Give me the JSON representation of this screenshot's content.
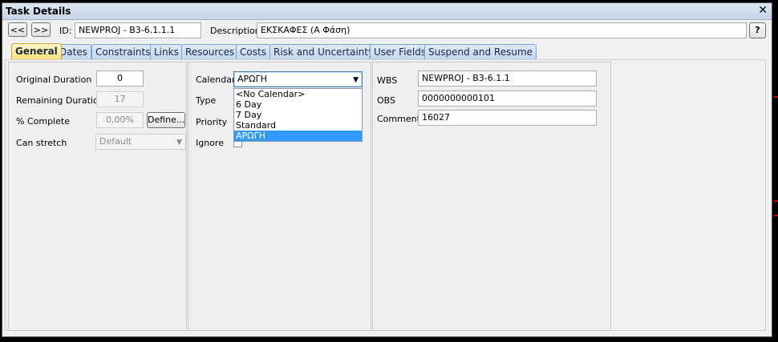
{
  "window": {
    "title": "Task Details",
    "close_glyph": "✕"
  },
  "header": {
    "prev_label": "<<",
    "next_label": ">>",
    "id_label": "ID:",
    "id_value": "NEWPROJ - B3-6.1.1.1",
    "description_label": "Description:",
    "description_value": "ΕΚΣΚΑΦΕΣ (Α Φάση)",
    "help_label": "?"
  },
  "tabs": [
    {
      "label": "General",
      "active": true
    },
    {
      "label": "Dates"
    },
    {
      "label": "Constraints"
    },
    {
      "label": "Links"
    },
    {
      "label": "Resources"
    },
    {
      "label": "Costs"
    },
    {
      "label": "Risk and Uncertainty"
    },
    {
      "label": "User Fields"
    },
    {
      "label": "Suspend and Resume"
    }
  ],
  "general": {
    "original_duration_label": "Original Duration",
    "original_duration_value": "0",
    "remaining_duration_label": "Remaining Duration",
    "remaining_duration_value": "17",
    "percent_complete_label": "% Complete",
    "percent_complete_value": "0,00%",
    "define_label": "Define...",
    "can_stretch_label": "Can stretch",
    "can_stretch_value": "Default"
  },
  "middle": {
    "calendar_label": "Calendar",
    "calendar_value": "ΑΡΩΓΗ",
    "type_label": "Type",
    "priority_label": "Priority",
    "ignore_label": "Ignore",
    "calendar_options": [
      "<No Calendar>",
      "6 Day",
      "7 Day",
      "Standard",
      "ΑΡΩΓΗ"
    ],
    "calendar_selected_index": 4
  },
  "right": {
    "wbs_label": "WBS",
    "wbs_value": "NEWPROJ - B3-6.1.1",
    "obs_label": "OBS",
    "obs_value": "0000000000101",
    "comment_label": "Comment",
    "comment_value": "16027"
  },
  "colors": {
    "active_tab": "#fbe27a",
    "inactive_tab": "#c1d6ef",
    "selection": "#3399ff",
    "titlebar": "#c8d6ea"
  }
}
